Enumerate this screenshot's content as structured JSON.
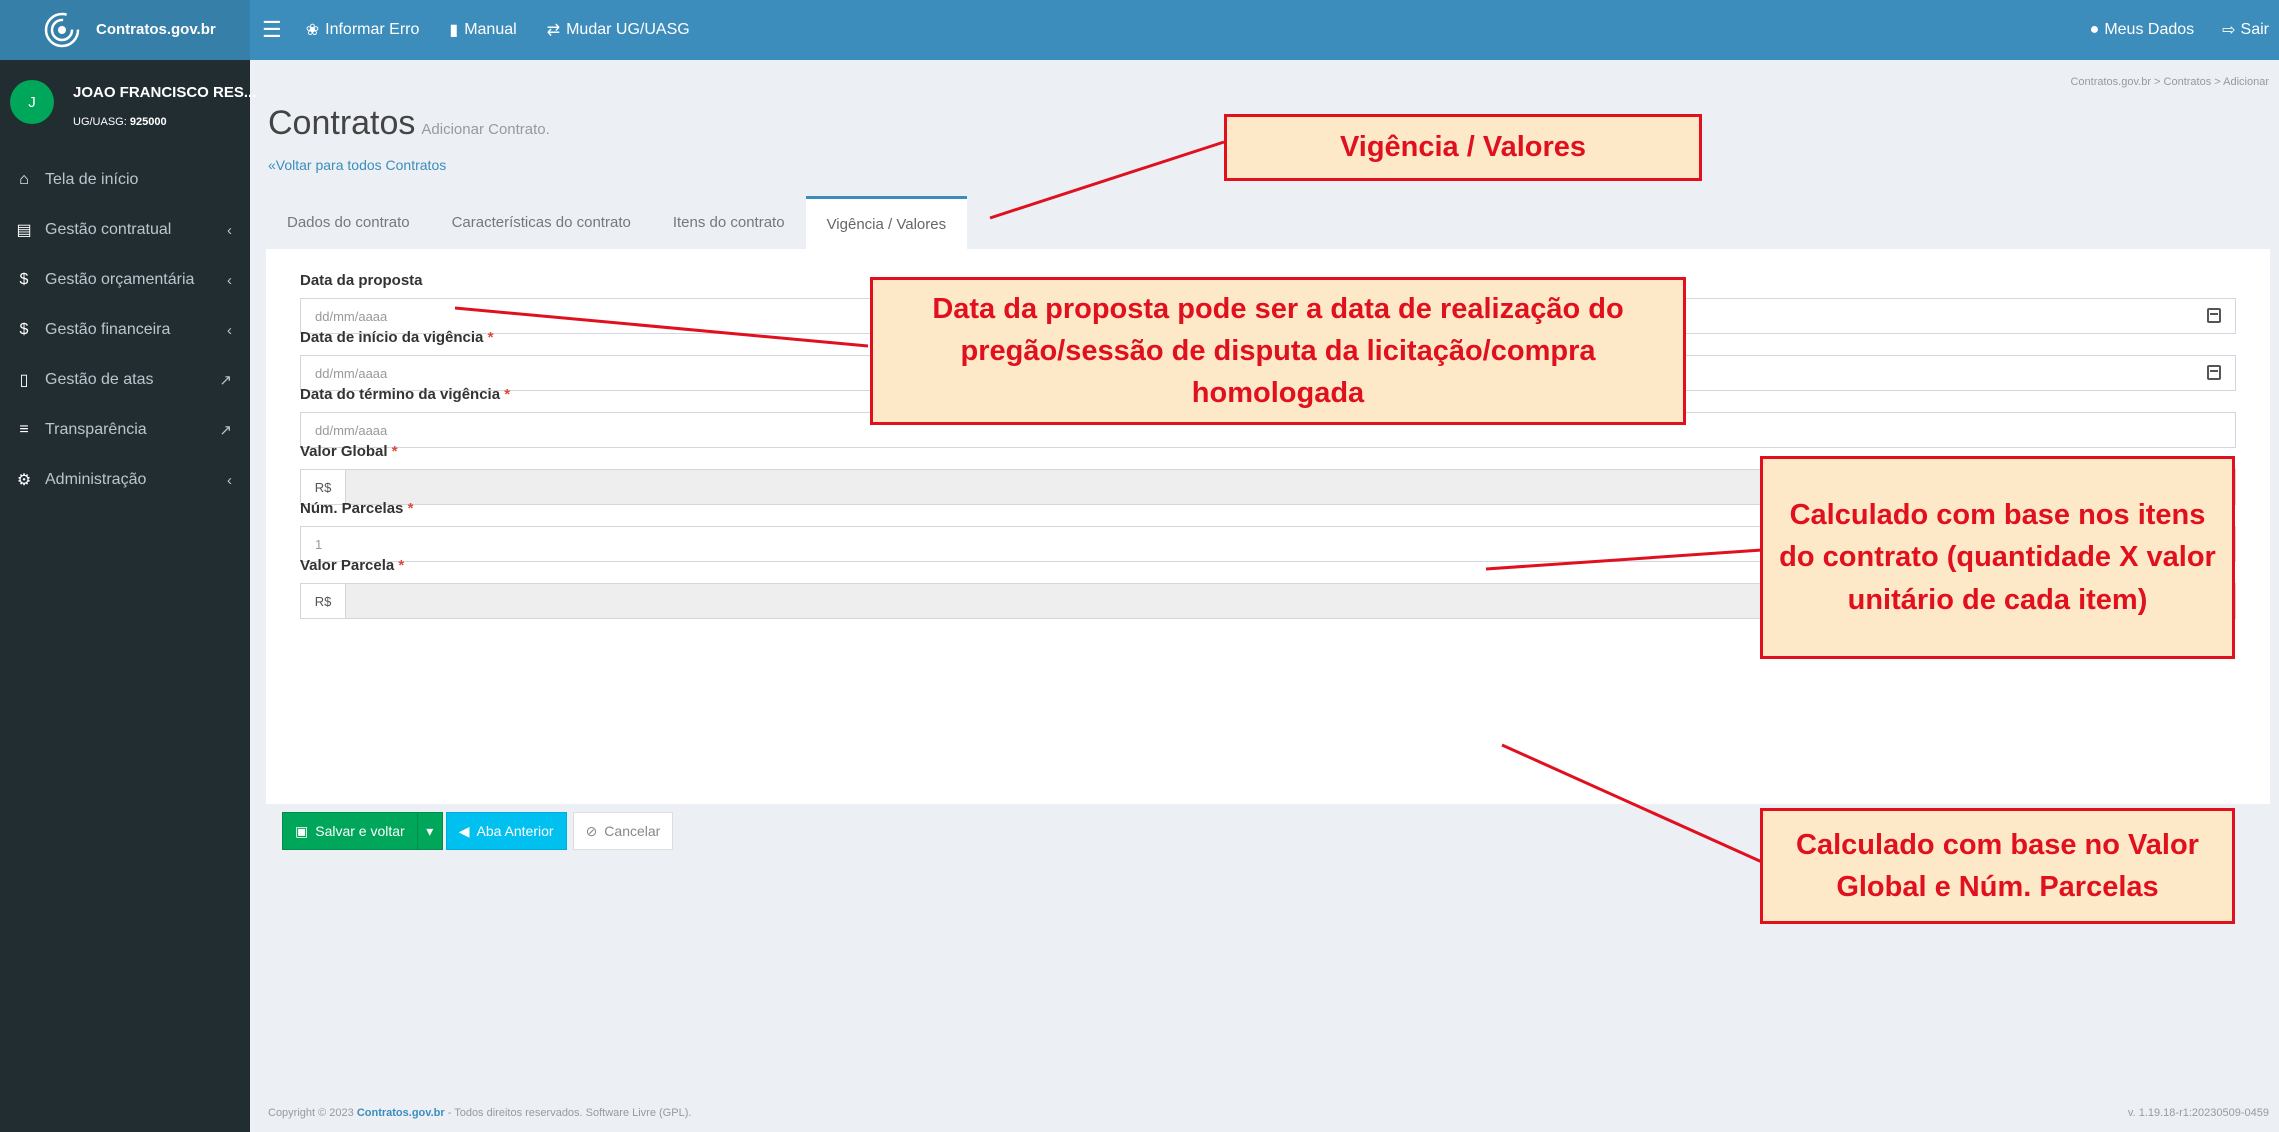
{
  "brand": {
    "name": "Contratos.gov.br"
  },
  "topnav": {
    "informar_erro": "Informar Erro",
    "manual": "Manual",
    "mudar_ug": "Mudar UG/UASG",
    "meus_dados": "Meus Dados",
    "sair": "Sair"
  },
  "user": {
    "initial": "J",
    "name": "JOAO FRANCISCO RES...",
    "uasg_label": "UG/UASG:",
    "uasg_value": "925000"
  },
  "sidebar": {
    "items": [
      {
        "label": "Tela de início",
        "icon": "home-icon"
      },
      {
        "label": "Gestão contratual",
        "icon": "file-icon"
      },
      {
        "label": "Gestão orçamentária",
        "icon": "dollar-icon"
      },
      {
        "label": "Gestão financeira",
        "icon": "dollar-icon"
      },
      {
        "label": "Gestão de atas",
        "icon": "document-icon"
      },
      {
        "label": "Transparência",
        "icon": "list-icon"
      },
      {
        "label": "Administração",
        "icon": "gears-icon"
      }
    ]
  },
  "page": {
    "title": "Contratos",
    "subtitle": "Adicionar Contrato.",
    "back_link": "Voltar para todos Contratos",
    "breadcrumb": "Contratos.gov.br  >  Contratos  >  Adicionar"
  },
  "tabs": [
    "Dados do contrato",
    "Características do contrato",
    "Itens do contrato",
    "Vigência / Valores"
  ],
  "form": {
    "data_proposta": {
      "label": "Data da proposta",
      "placeholder": "dd/mm/aaaa"
    },
    "data_inicio": {
      "label": "Data de início da vigência",
      "placeholder": "dd/mm/aaaa"
    },
    "data_termino": {
      "label": "Data do término da vigência",
      "placeholder": "dd/mm/aaaa"
    },
    "valor_global": {
      "label": "Valor Global",
      "prefix": "R$"
    },
    "num_parcelas": {
      "label": "Núm. Parcelas",
      "value": "1"
    },
    "valor_parcela": {
      "label": "Valor Parcela",
      "prefix": "R$"
    },
    "required_mark": "*"
  },
  "buttons": {
    "save": "Salvar e voltar",
    "prev": "Aba Anterior",
    "cancel": "Cancelar"
  },
  "footer": {
    "copyright_prefix": "Copyright © 2023",
    "brand": "Contratos.gov.br",
    "copyright_suffix": "- Todos direitos reservados. Software Livre (GPL).",
    "version": "v. 1.19.18-r1:20230509-0459"
  },
  "annotations": {
    "vigencia": "Vigência / Valores",
    "proposta": "Data da proposta pode ser a data de realização do pregão/sessão de disputa da licitação/compra homologada",
    "valor_global": "Calculado com base nos itens do contrato (quantidade X valor unitário de cada item)",
    "valor_parcela": "Calculado com base no Valor Global e Núm. Parcelas"
  },
  "colors": {
    "header": "#3c8dbc",
    "sidebar": "#222d32",
    "annotation_border": "#e0101e",
    "annotation_fill": "#fde9c8"
  }
}
